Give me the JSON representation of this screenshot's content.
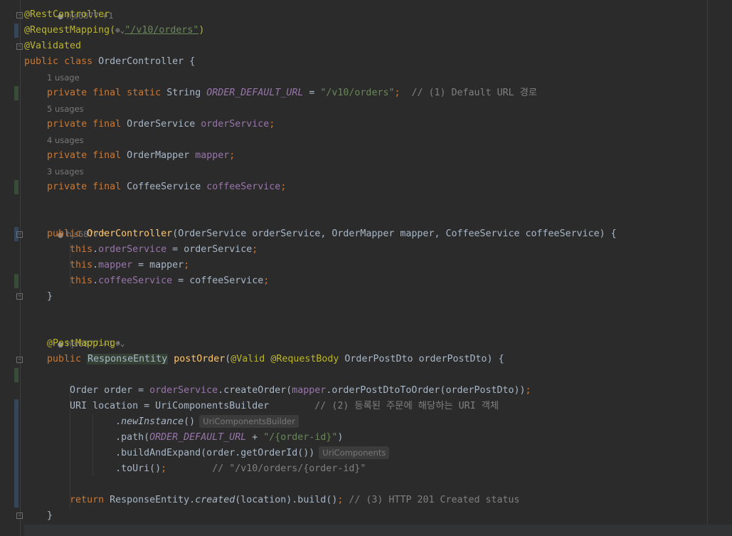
{
  "editor": {
    "hints": {
      "top_author": "hjs6877 +1",
      "usage_1": "1 usage",
      "usage_5": "5 usages",
      "usage_4": "4 usages",
      "usage_3": "3 usages",
      "ctor_author": "hjs6877 *",
      "post_author": "hjs6877 +1 *"
    },
    "code": {
      "ann_rest": "@RestController",
      "ann_request_mapping": "@RequestMapping(",
      "request_mapping_value": "\"/v10/orders\"",
      "ann_validated": "@Validated",
      "kw_public": "public",
      "kw_class": "class",
      "class_name": "OrderController {",
      "kw_private": "private",
      "kw_final": "final",
      "kw_static": "static",
      "type_string": "String",
      "const_default_url": "ORDER_DEFAULT_URL",
      "str_default_url": "\"/v10/orders\"",
      "cmt_default_url": "// (1) Default URL 경로",
      "type_order_service": "OrderService",
      "field_order_service": "orderService",
      "type_order_mapper": "OrderMapper",
      "field_mapper": "mapper",
      "type_coffee_service": "CoffeeService",
      "field_coffee_service": "coffeeService",
      "ctor_name": "OrderController",
      "ctor_params": "OrderService orderService, OrderMapper mapper, CoffeeService coffeeService) {",
      "this": "this",
      "assign_order_service": " = orderService",
      "assign_mapper": " = mapper",
      "assign_coffee_service": " = coffeeService",
      "close_brace": "}",
      "ann_post_mapping": "@PostMapping",
      "type_response_entity": "ResponseEntity",
      "method_post_order": "postOrder",
      "ann_valid": "@Valid",
      "ann_request_body": "@RequestBody",
      "post_params": "OrderPostDto orderPostDto) {",
      "order_decl": "Order order = ",
      "create_order_call": ".createOrder(",
      "mapper_call": ".orderPostDtoToOrder(orderPostDto))",
      "uri_decl": "URI location = UriComponentsBuilder",
      "cmt_uri": "// (2) 등록된 주문에 해당하는 URI 객체",
      "new_instance": "newInstance",
      "hint_builder": "UriComponentsBuilder",
      "path_call": ".path(",
      "path_suffix": "\"/{order-id}\"",
      "build_expand": ".buildAndExpand(order.getOrderId())",
      "hint_components": "UriComponents",
      "to_uri": ".toUri()",
      "cmt_to_uri": "// \"/v10/orders/{order-id}\"",
      "kw_return": "return",
      "return_expr_a": "ResponseEntity.",
      "return_created": "created",
      "return_expr_b": "(location).build()",
      "cmt_return": "// (3) HTTP 201 Created status"
    }
  }
}
